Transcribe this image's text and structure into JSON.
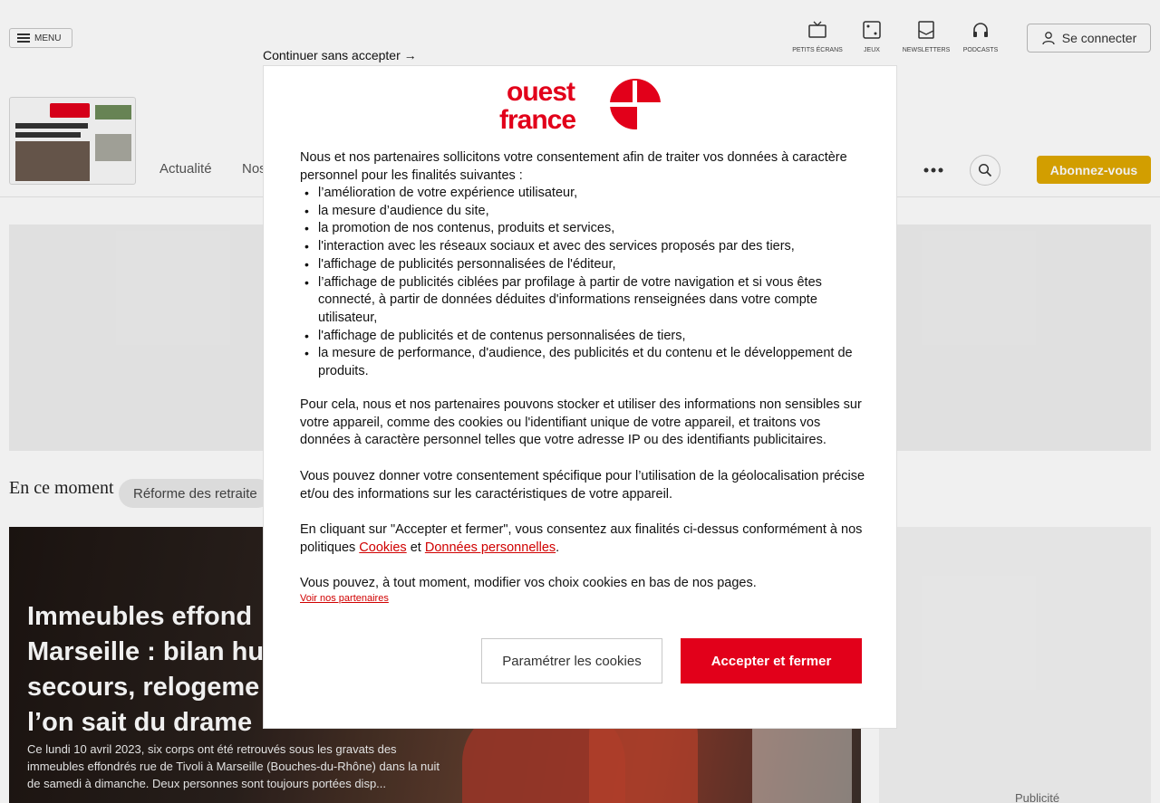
{
  "header": {
    "menu_label": "MENU",
    "quick_links": [
      {
        "label": "PETITS ÉCRANS",
        "icon": "tv-icon"
      },
      {
        "label": "JEUX",
        "icon": "dice-icon"
      },
      {
        "label": "NEWSLETTERS",
        "icon": "newsletter-icon"
      },
      {
        "label": "PODCASTS",
        "icon": "headphones-icon"
      }
    ],
    "login_label": "Se connecter"
  },
  "nav": {
    "items": [
      "Actualité",
      "Nos"
    ],
    "subscribe_label": "Abonnez-vous",
    "subscribe_color": "#e0a800"
  },
  "trending": {
    "title": "En ce moment",
    "chip": "Réforme des retraite"
  },
  "hero": {
    "title": "Immeubles effondr... Marseille : bilan hu... secours, relogeme... l’on sait du drame",
    "title_lines": [
      "Immeubles effond",
      "Marseille : bilan hu",
      "secours, relogeme",
      "l’on sait du drame"
    ],
    "summary": "Ce lundi 10 avril 2023, six corps ont été retrouvés sous les gravats des immeubles effondrés rue de Tivoli à Marseille (Bouches-du-Rhône) dans la nuit de samedi à dimanche. Deux personnes sont toujours portées disp..."
  },
  "side_ad": {
    "pub_label": "Publicité"
  },
  "consent": {
    "skip_label": "Continuer sans accepter →",
    "brand_color": "#e2001a",
    "logo_top": "ouest",
    "logo_bottom": "france",
    "intro": "Nous et nos partenaires sollicitons votre consentement afin de traiter vos données à caractère personnel pour les finalités suivantes :",
    "purposes": [
      "l’amélioration de votre expérience utilisateur,",
      "la mesure d’audience du site,",
      "la promotion de nos contenus, produits et services,",
      "l'interaction avec les réseaux sociaux et avec des services proposés par des tiers,",
      "l'affichage de publicités personnalisées de l'éditeur,",
      "l’affichage de publicités ciblées par profilage à partir de votre navigation et si vous êtes connecté, à partir de données déduites d'informations renseignées dans votre compte utilisateur,",
      "l'affichage de publicités et de contenus personnalisées de tiers,",
      "la mesure de performance, d'audience, des publicités et du contenu et le développement de produits."
    ],
    "storage_text": "Pour cela, nous et nos partenaires pouvons stocker et utiliser des informations non sensibles sur votre appareil, comme des cookies ou l'identifiant unique de votre appareil, et traitons vos données à caractère personnel telles que votre adresse IP ou des identifiants publicitaires.",
    "geo_text": "Vous pouvez donner votre consentement spécifique pour l’utilisation de la géolocalisation précise et/ou des informations sur les caractéristiques de votre appareil.",
    "accept_text_before": "En cliquant sur \"Accepter et fermer\", vous consentez aux finalités ci-dessus conformément à nos politiques ",
    "cookies_link": "Cookies",
    "and_text": " et ",
    "personal_data_link": "Données personnelles",
    "accept_text_after": ".",
    "modify_text": "Vous pouvez, à tout moment, modifier vos choix cookies en bas de nos pages.",
    "partners_link": "Voir nos partenaires",
    "settings_button": "Paramétrer les cookies",
    "accept_button": "Accepter et fermer"
  }
}
